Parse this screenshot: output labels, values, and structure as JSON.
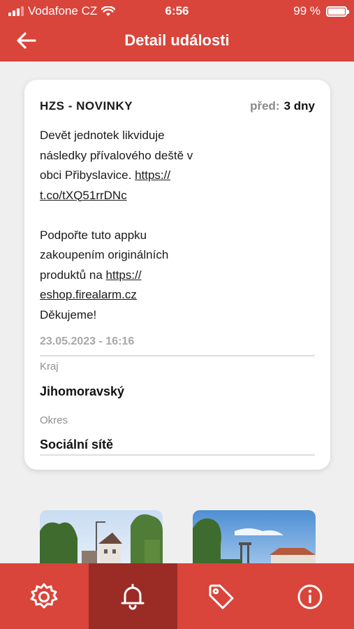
{
  "status_bar": {
    "carrier": "Vodafone CZ",
    "time": "6:56",
    "battery": "99 %"
  },
  "header": {
    "title": "Detail události",
    "back_icon": "arrow-left-icon"
  },
  "event": {
    "source": "HZS - NOVINKY",
    "ago_label": "před:",
    "ago_value": "3 dny",
    "text_line1": "Devět jednotek likviduje",
    "text_line2": "následky přívalového deště v",
    "text_line3_prefix": "obci Přibyslavice.",
    "link1_part1": "https://",
    "link1_part2": "t.co/tXQ51rrDNc",
    "promo_line1": "Podpořte tuto appku",
    "promo_line2": "zakoupením originálních",
    "promo_line3_prefix": "produktů na",
    "link2_part1": "https://",
    "link2_part2": "eshop.firealarm.cz",
    "thanks": "Děkujeme!",
    "datetime": "23.05.2023 - 16:16",
    "region_label": "Kraj",
    "region_value": "Jihomoravský",
    "district_label": "Okres",
    "district_value": "Sociální sítě"
  },
  "tabbar": {
    "items": [
      {
        "icon": "settings-gear-icon",
        "active": false
      },
      {
        "icon": "bell-icon",
        "active": true
      },
      {
        "icon": "tag-icon",
        "active": false
      },
      {
        "icon": "info-icon",
        "active": false
      }
    ]
  },
  "colors": {
    "brand_red": "#d9443b",
    "active_tab": "#9b2b25",
    "background": "#efefef"
  }
}
